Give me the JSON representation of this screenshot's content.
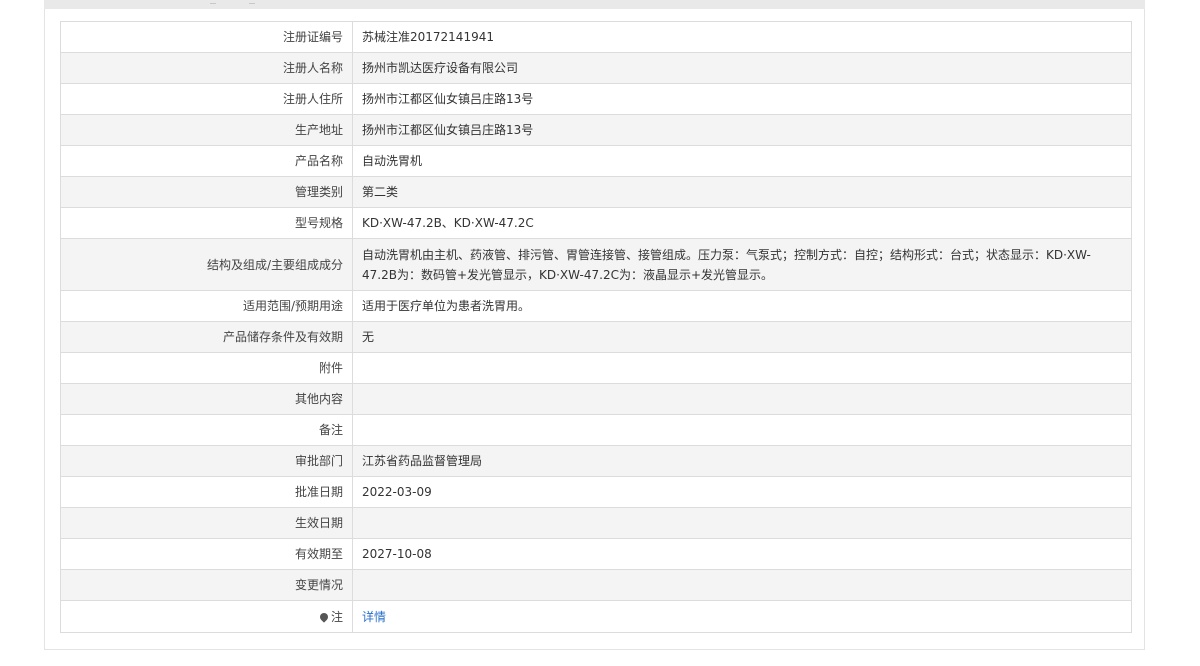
{
  "rows": [
    {
      "label": "注册证编号",
      "value": "苏械注准20172141941"
    },
    {
      "label": "注册人名称",
      "value": "扬州市凯达医疗设备有限公司"
    },
    {
      "label": "注册人住所",
      "value": "扬州市江都区仙女镇吕庄路13号"
    },
    {
      "label": "生产地址",
      "value": "扬州市江都区仙女镇吕庄路13号"
    },
    {
      "label": "产品名称",
      "value": "自动洗胃机"
    },
    {
      "label": "管理类别",
      "value": "第二类"
    },
    {
      "label": "型号规格",
      "value": "KD·XW-47.2B、KD·XW-47.2C"
    },
    {
      "label": "结构及组成/主要组成成分",
      "value": "自动洗胃机由主机、药液管、排污管、胃管连接管、接管组成。压力泵：气泵式；控制方式：自控；结构形式：台式；状态显示：KD·XW-47.2B为：数码管+发光管显示，KD·XW-47.2C为：液晶显示+发光管显示。"
    },
    {
      "label": "适用范围/预期用途",
      "value": "适用于医疗单位为患者洗胃用。"
    },
    {
      "label": "产品储存条件及有效期",
      "value": "无"
    },
    {
      "label": "附件",
      "value": ""
    },
    {
      "label": "其他内容",
      "value": ""
    },
    {
      "label": "备注",
      "value": ""
    },
    {
      "label": "审批部门",
      "value": "江苏省药品监督管理局"
    },
    {
      "label": "批准日期",
      "value": "2022-03-09"
    },
    {
      "label": "生效日期",
      "value": ""
    },
    {
      "label": "有效期至",
      "value": "2027-10-08"
    },
    {
      "label": "变更情况",
      "value": ""
    }
  ],
  "note": {
    "icon": "pin-icon",
    "label": "注",
    "link_text": "详情",
    "link_color": "#2a6fc9"
  }
}
